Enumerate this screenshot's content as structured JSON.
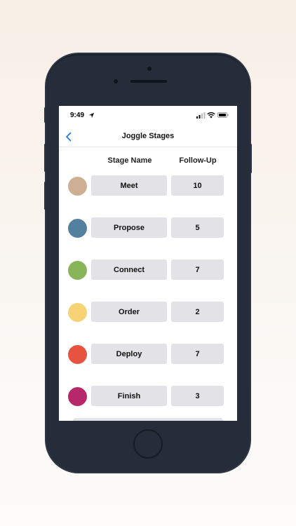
{
  "status_bar": {
    "time": "9:49"
  },
  "nav": {
    "title": "Joggle Stages",
    "back_icon": "chevron-left-icon"
  },
  "columns": {
    "stage_name": "Stage Name",
    "follow_up": "Follow-Up"
  },
  "stages": [
    {
      "name": "Meet",
      "follow_up": "10",
      "color": "#cfaf93"
    },
    {
      "name": "Propose",
      "follow_up": "5",
      "color": "#52809e"
    },
    {
      "name": "Connect",
      "follow_up": "7",
      "color": "#88b55a"
    },
    {
      "name": "Order",
      "follow_up": "2",
      "color": "#f6d476"
    },
    {
      "name": "Deploy",
      "follow_up": "7",
      "color": "#e6533f"
    },
    {
      "name": "Finish",
      "follow_up": "3",
      "color": "#b7286a"
    }
  ],
  "colors": {
    "accent": "#1a73e8",
    "field_bg": "#e3e3e7",
    "device": "#262d3a"
  }
}
